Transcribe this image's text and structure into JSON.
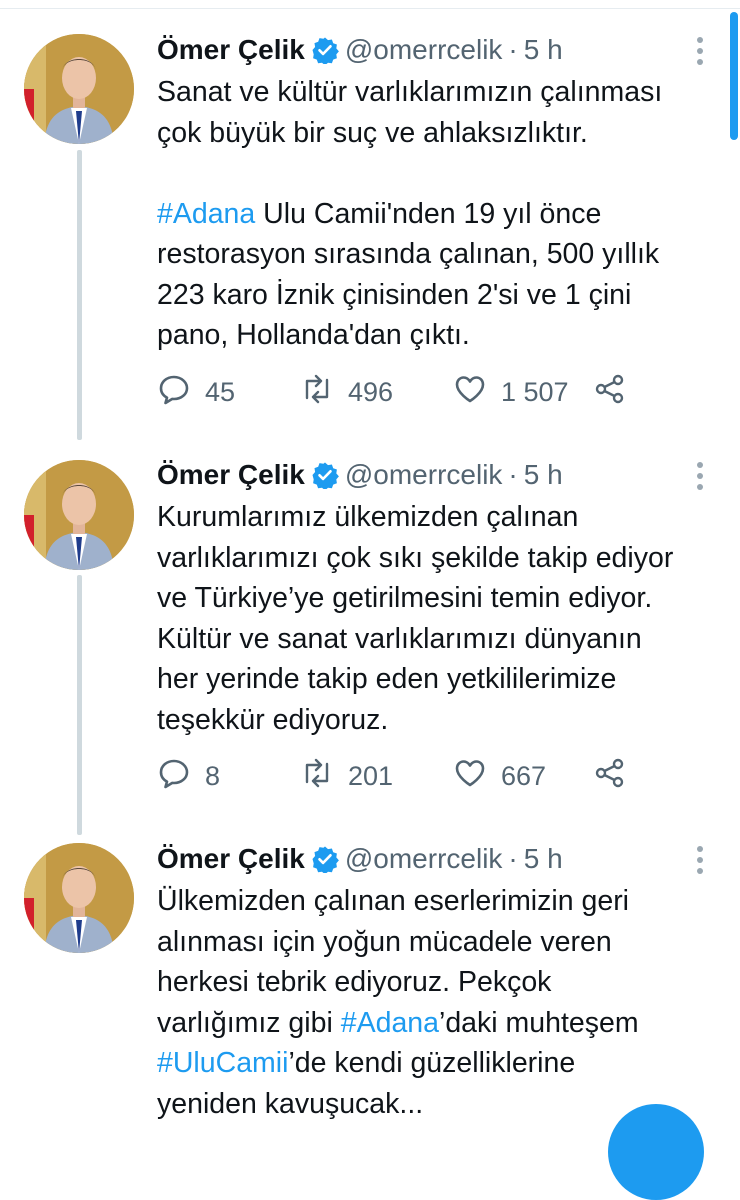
{
  "colors": {
    "accent": "#1d9bf0",
    "text": "#0f1419",
    "secondary": "#536471",
    "thread_line": "#cfd9de"
  },
  "tweets": [
    {
      "name": "Ömer Çelik",
      "handle": "@omerrcelik",
      "separator": "·",
      "time": "5 h",
      "text_parts": [
        "Sanat ve kültür varlıklarımızın çalınması\nçok büyük bir suç ve ahlaksızlıktır.\n\n",
        "#Adana",
        " Ulu Camii'nden 19 yıl önce\nrestorasyon sırasında çalınan, 500 yıllık\n223 karo İznik çinisinden 2'si ve 1 çini\npano, Hollanda'dan çıktı."
      ],
      "replies": "45",
      "retweets": "496",
      "likes": "1 507"
    },
    {
      "name": "Ömer Çelik",
      "handle": "@omerrcelik",
      "separator": "·",
      "time": "5 h",
      "text_parts": [
        "Kurumlarımız ülkemizden çalınan\nvarlıklarımızı çok sıkı şekilde takip ediyor\nve Türkiye’ye getirilmesini temin ediyor.\nKültür ve sanat varlıklarımızı dünyanın\nher yerinde takip eden yetkililerimize\nteşekkür ediyoruz."
      ],
      "replies": "8",
      "retweets": "201",
      "likes": "667"
    },
    {
      "name": "Ömer Çelik",
      "handle": "@omerrcelik",
      "separator": "·",
      "time": "5 h",
      "text_parts": [
        "Ülkemizden çalınan eserlerimizin geri\nalınması için yoğun mücadele veren\nherkesi tebrik ediyoruz. Pekçok\nvarlığımız gibi ",
        "#Adana",
        "’daki muhteşem\n",
        "#UluCamii",
        "’de kendi güzelliklerine\nyeniden kavuşucak..."
      ]
    }
  ],
  "icons": {
    "reply": "reply-icon",
    "retweet": "retweet-icon",
    "like": "heart-icon",
    "share": "share-icon",
    "more": "more-icon",
    "verified": "verified-badge-icon"
  }
}
